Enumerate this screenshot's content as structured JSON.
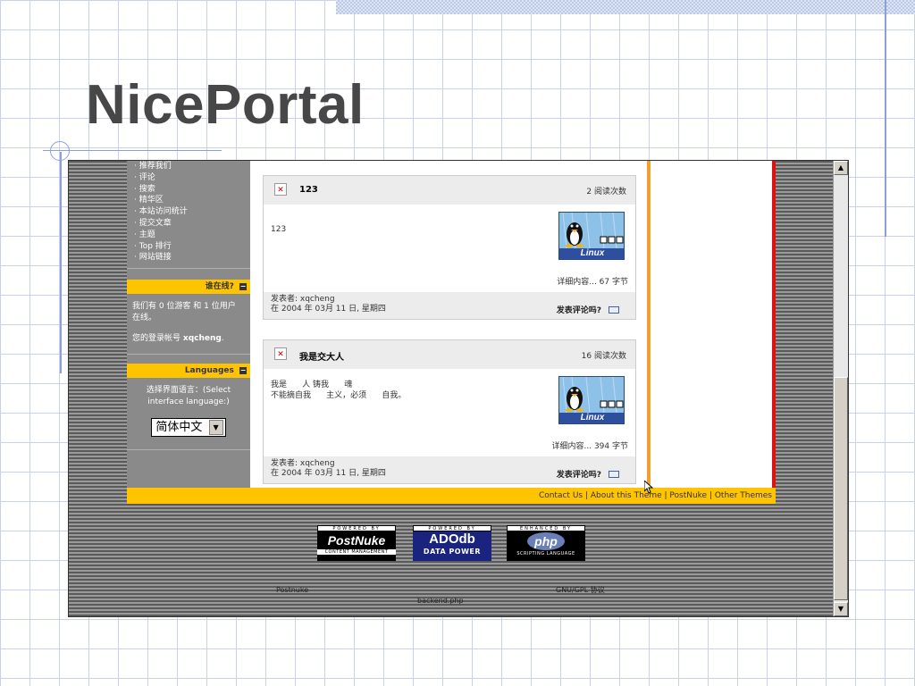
{
  "slide": {
    "title": "NicePortal"
  },
  "sidebar": {
    "menu_items": [
      "推荐我们",
      "评论",
      "搜索",
      "精华区",
      "本站访问统计",
      "提交文章",
      "主题",
      "Top 排行",
      "网站链接"
    ],
    "online": {
      "header": "谁在线?",
      "line1": "我们有 0 位游客 和 1 位用户 在线。",
      "line2_prefix": "您的登录帐号",
      "username": "xqcheng",
      "line2_suffix": "."
    },
    "languages": {
      "header": "Languages",
      "prompt": "选择界面语言：(Select interface language:)",
      "selected": "简体中文"
    }
  },
  "articles": [
    {
      "title": "123",
      "reads": "2 阅读次数",
      "text_lines": [
        "123"
      ],
      "more": "详细内容... 67 字节",
      "author": "发表者: xqcheng",
      "date": "在 2004 年 03月 11 日, 星期四",
      "comment": "发表评论吗?",
      "logo_text": "Linux"
    },
    {
      "title": "我是交大人",
      "reads": "16 阅读次数",
      "text_lines": [
        "我是      人 铸我      魂",
        "不能摘自我      主义，必须      自我。"
      ],
      "more": "详细内容... 394 字节",
      "author": "发表者: xqcheng",
      "date": "在 2004 年 03月 11 日, 星期四",
      "comment": "发表评论吗?",
      "logo_text": "Linux"
    }
  ],
  "footer_links": "Contact Us | About this Theme | PostNuke | Other Themes",
  "badges": [
    {
      "top": "POWERED BY",
      "main": "PostNuke",
      "sub": "CONTENT MANAGEMENT",
      "bg": "#000000"
    },
    {
      "top": "POWERED BY",
      "main": "ADOdb",
      "sub": "DATA POWER",
      "bg": "#1a237e"
    },
    {
      "top": "ENHANCED BY",
      "main": "php",
      "sub": "SCRIPTING LANGUAGE",
      "bg": "#000000"
    }
  ],
  "credits": {
    "postnuke": "Postnuke",
    "license": "GNU/GPL 协议",
    "backend": "backend.php"
  },
  "colors": {
    "accent_yellow": "#ffc400",
    "side_orange": "#f0a030",
    "side_red": "#dd1111",
    "title_gray": "#474747"
  }
}
